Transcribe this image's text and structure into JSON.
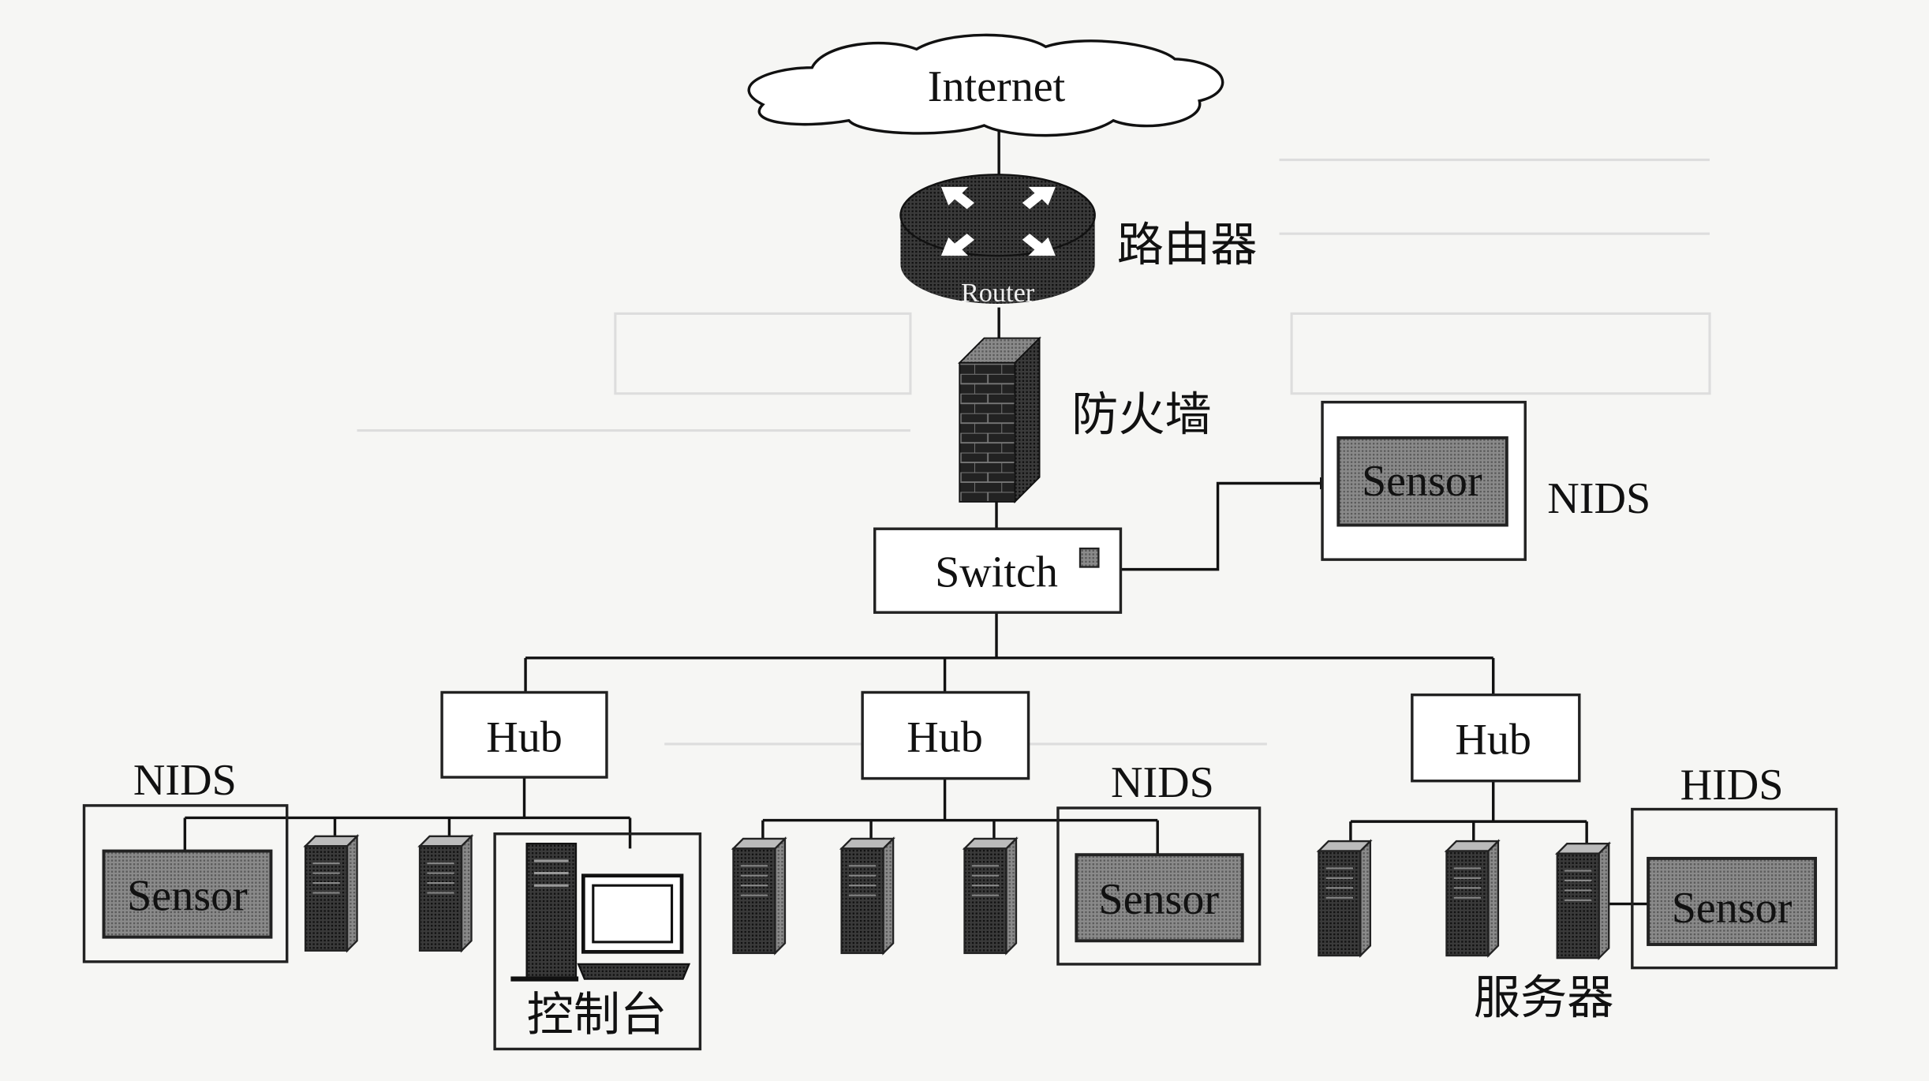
{
  "internet": {
    "label": "Internet"
  },
  "router": {
    "label": "路由器",
    "device_text": "Router"
  },
  "firewall": {
    "label": "防火墙"
  },
  "switch": {
    "label": "Switch"
  },
  "top_nids": {
    "sensor": "Sensor",
    "label": "NIDS"
  },
  "hubs": [
    {
      "label": "Hub"
    },
    {
      "label": "Hub"
    },
    {
      "label": "Hub"
    }
  ],
  "left_group": {
    "nids_label": "NIDS",
    "sensor": "Sensor",
    "console_label": "控制台"
  },
  "middle_group": {
    "nids_label": "NIDS",
    "sensor": "Sensor"
  },
  "right_group": {
    "hids_label": "HIDS",
    "sensor": "Sensor",
    "servers_label": "服务器"
  },
  "colors": {
    "sensor_fill": "#7a7a7a",
    "device_dark": "#2a2a2a",
    "background": "#f6f6f4"
  }
}
